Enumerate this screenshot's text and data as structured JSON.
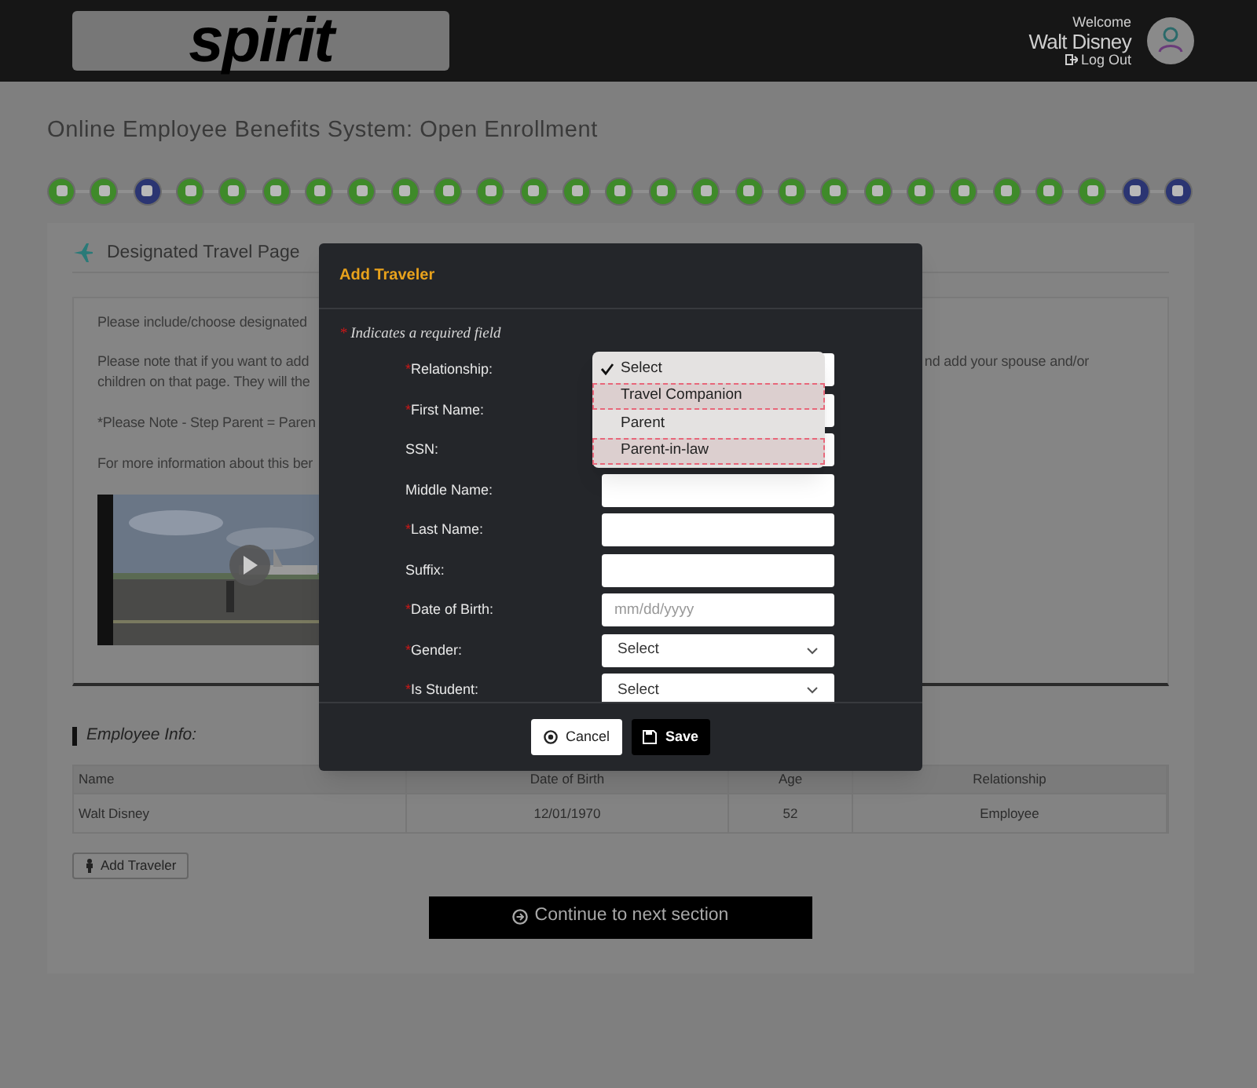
{
  "header": {
    "logo": "spirit",
    "welcome": "Welcome",
    "user_name": "Walt Disney",
    "logout": "Log Out"
  },
  "page_title": "Online Employee Benefits System: Open Enrollment",
  "steps": [
    {
      "color": "#3f8a2a"
    },
    {
      "color": "#3f8a2a"
    },
    {
      "color": "#2b3572"
    },
    {
      "color": "#3f8a2a"
    },
    {
      "color": "#3f8a2a"
    },
    {
      "color": "#3f8a2a"
    },
    {
      "color": "#3f8a2a"
    },
    {
      "color": "#3f8a2a"
    },
    {
      "color": "#3f8a2a"
    },
    {
      "color": "#3f8a2a"
    },
    {
      "color": "#3f8a2a"
    },
    {
      "color": "#3f8a2a"
    },
    {
      "color": "#3f8a2a"
    },
    {
      "color": "#3f8a2a"
    },
    {
      "color": "#3f8a2a"
    },
    {
      "color": "#3f8a2a"
    },
    {
      "color": "#3f8a2a"
    },
    {
      "color": "#3f8a2a"
    },
    {
      "color": "#3f8a2a"
    },
    {
      "color": "#3f8a2a"
    },
    {
      "color": "#3f8a2a"
    },
    {
      "color": "#3f8a2a"
    },
    {
      "color": "#3f8a2a"
    },
    {
      "color": "#3f8a2a"
    },
    {
      "color": "#3f8a2a"
    },
    {
      "color": "#2b3572"
    },
    {
      "color": "#2b3572"
    }
  ],
  "section_title": "Designated Travel Page",
  "info_lines": [
    {
      "left": "Please include/choose designated"
    },
    {
      "left": "Please note that if you want to add",
      "right": "nd add your spouse and/or"
    },
    {
      "left": "children on that page.  They will the"
    },
    {
      "left": "*Please Note - Step Parent = Paren"
    },
    {
      "left": "For more information about this ber"
    }
  ],
  "employee_info": {
    "title": "Employee Info:",
    "columns": [
      "Name",
      "Date of Birth",
      "Age",
      "Relationship"
    ],
    "rows": [
      [
        "Walt Disney",
        "12/01/1970",
        "52",
        "Employee"
      ]
    ]
  },
  "add_traveler_button": "Add Traveler",
  "continue_button": "Continue to next section",
  "modal": {
    "title": "Add Traveler",
    "required_mark": "*",
    "required_note": "Indicates a required field",
    "fields": [
      {
        "label": "Relationship:",
        "required": true,
        "kind": "select"
      },
      {
        "label": "First Name:",
        "required": true,
        "kind": "input"
      },
      {
        "label": "SSN:",
        "required": false,
        "kind": "input"
      },
      {
        "label": "Middle Name:",
        "required": false,
        "kind": "input"
      },
      {
        "label": "Last Name:",
        "required": true,
        "kind": "input"
      },
      {
        "label": "Suffix:",
        "required": false,
        "kind": "input"
      },
      {
        "label": "Date of Birth:",
        "required": true,
        "kind": "input",
        "placeholder": "mm/dd/yyyy"
      },
      {
        "label": "Gender:",
        "required": true,
        "kind": "select",
        "value": "Select"
      },
      {
        "label": "Is Student:",
        "required": true,
        "kind": "select",
        "value": "Select"
      }
    ],
    "dropdown": [
      {
        "label": "Select",
        "selected": true,
        "marked": false
      },
      {
        "label": "Travel Companion",
        "selected": false,
        "marked": true
      },
      {
        "label": "Parent",
        "selected": false,
        "marked": false
      },
      {
        "label": "Parent-in-law",
        "selected": false,
        "marked": true
      }
    ],
    "buttons": [
      {
        "label": "Cancel",
        "kind": "cancel"
      },
      {
        "label": "Save",
        "kind": "save"
      }
    ]
  }
}
